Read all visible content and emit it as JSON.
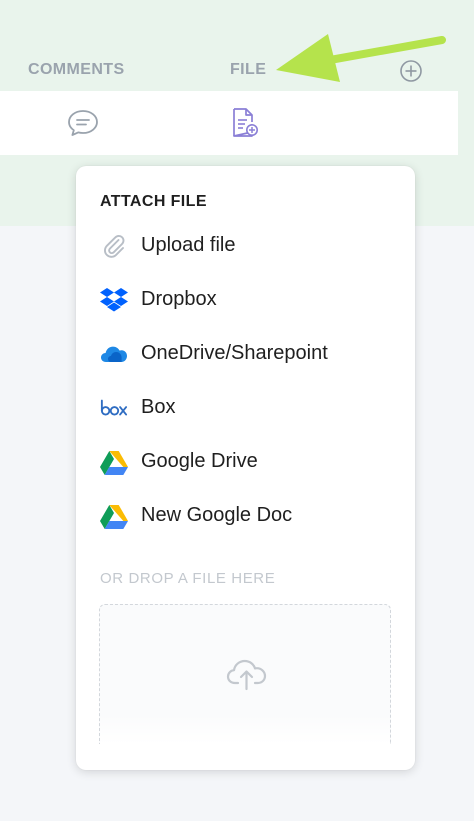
{
  "tabs": {
    "comments_label": "COMMENTS",
    "file_label": "FILE"
  },
  "icons": {
    "add": "plus-circle-icon",
    "comments": "speech-bubble-icon",
    "file": "document-plus-icon",
    "arrow": "pointer-arrow"
  },
  "menu": {
    "title": "ATTACH FILE",
    "items": [
      {
        "label": "Upload file",
        "icon": "paperclip-icon"
      },
      {
        "label": "Dropbox",
        "icon": "dropbox-icon"
      },
      {
        "label": "OneDrive/Sharepoint",
        "icon": "onedrive-icon"
      },
      {
        "label": "Box",
        "icon": "box-icon"
      },
      {
        "label": "Google Drive",
        "icon": "google-drive-icon"
      },
      {
        "label": "New Google Doc",
        "icon": "google-drive-icon"
      }
    ],
    "drop_label": "OR DROP A FILE HERE"
  },
  "colors": {
    "arrow": "#b5e34c",
    "accent": "#8a7fd6",
    "top_panel": "#e9f4ec",
    "dropbox": "#0061fe",
    "onedrive": "#1e88e5",
    "box": "#2f6dc2"
  }
}
